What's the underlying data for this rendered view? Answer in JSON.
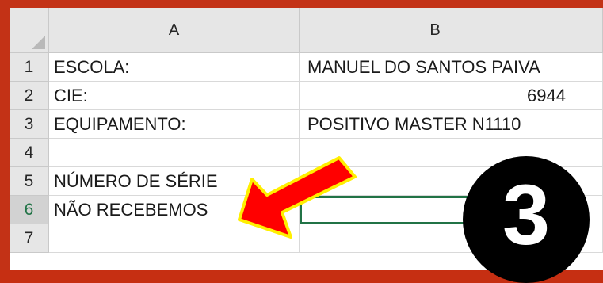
{
  "columns": [
    "A",
    "B"
  ],
  "rows": [
    {
      "num": "1",
      "a": "ESCOLA:",
      "b": "MANUEL DO SANTOS PAIVA",
      "b_align": "left"
    },
    {
      "num": "2",
      "a": "CIE:",
      "b": "6944",
      "b_align": "right"
    },
    {
      "num": "3",
      "a": "EQUIPAMENTO:",
      "b": "POSITIVO MASTER N1110",
      "b_align": "left"
    },
    {
      "num": "4",
      "a": "",
      "b": "",
      "b_align": "left"
    },
    {
      "num": "5",
      "a": "NÚMERO DE SÉRIE",
      "b": "",
      "b_align": "left"
    },
    {
      "num": "6",
      "a": "NÃO RECEBEMOS",
      "b": "",
      "b_align": "left"
    },
    {
      "num": "7",
      "a": "",
      "b": "",
      "b_align": "left"
    }
  ],
  "selected_cell": "B6",
  "step_badge": "3",
  "colors": {
    "frame": "#c33216",
    "header_bg": "#e6e6e6",
    "selection": "#217346",
    "arrow_fill": "#ff0000",
    "arrow_outline": "#ffef00",
    "badge_bg": "#000000",
    "badge_text": "#ffffff"
  },
  "icons": {
    "select_all": "select-all-triangle-icon",
    "pointer": "red-arrow-icon"
  }
}
